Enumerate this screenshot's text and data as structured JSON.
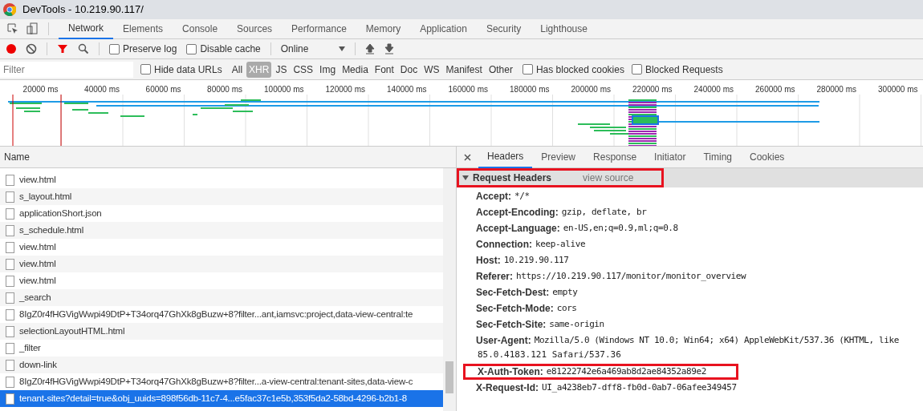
{
  "window": {
    "title": "DevTools - 10.219.90.117/"
  },
  "tabs": [
    {
      "label": "Network",
      "selected": true
    },
    {
      "label": "Elements",
      "selected": false
    },
    {
      "label": "Console",
      "selected": false
    },
    {
      "label": "Sources",
      "selected": false
    },
    {
      "label": "Performance",
      "selected": false
    },
    {
      "label": "Memory",
      "selected": false
    },
    {
      "label": "Application",
      "selected": false
    },
    {
      "label": "Security",
      "selected": false
    },
    {
      "label": "Lighthouse",
      "selected": false
    }
  ],
  "toolbar": {
    "recording": true,
    "filter_active": true,
    "preserve_log": {
      "label": "Preserve log",
      "checked": false
    },
    "disable_cache": {
      "label": "Disable cache",
      "checked": false
    },
    "throttling": "Online"
  },
  "filter_bar": {
    "placeholder": "Filter",
    "hide_data_urls": {
      "label": "Hide data URLs",
      "checked": false
    },
    "types": [
      {
        "label": "All",
        "selected": false
      },
      {
        "label": "XHR",
        "selected": true
      },
      {
        "label": "JS",
        "selected": false
      },
      {
        "label": "CSS",
        "selected": false
      },
      {
        "label": "Img",
        "selected": false
      },
      {
        "label": "Media",
        "selected": false
      },
      {
        "label": "Font",
        "selected": false
      },
      {
        "label": "Doc",
        "selected": false
      },
      {
        "label": "WS",
        "selected": false
      },
      {
        "label": "Manifest",
        "selected": false
      },
      {
        "label": "Other",
        "selected": false
      }
    ],
    "has_blocked_cookies": {
      "label": "Has blocked cookies",
      "checked": false
    },
    "blocked_requests": {
      "label": "Blocked Requests",
      "checked": false
    }
  },
  "overview": {
    "ticks": [
      "20000 ms",
      "40000 ms",
      "60000 ms",
      "80000 ms",
      "100000 ms",
      "120000 ms",
      "140000 ms",
      "160000 ms",
      "180000 ms",
      "200000 ms",
      "220000 ms",
      "240000 ms",
      "260000 ms",
      "280000 ms",
      "300000 ms"
    ]
  },
  "requests": {
    "column": "Name",
    "rows": [
      {
        "name": "view.html",
        "selected": false
      },
      {
        "name": "s_layout.html",
        "selected": false
      },
      {
        "name": "applicationShort.json",
        "selected": false
      },
      {
        "name": "s_schedule.html",
        "selected": false
      },
      {
        "name": "view.html",
        "selected": false
      },
      {
        "name": "view.html",
        "selected": false
      },
      {
        "name": "view.html",
        "selected": false
      },
      {
        "name": "_search",
        "selected": false
      },
      {
        "name": "8IgZ0r4fHGVigWwpi49DtP+T34orq47GhXk8gBuzw+8?filter...ant,iamsvc:project,data-view-central:te",
        "selected": false
      },
      {
        "name": "selectionLayoutHTML.html",
        "selected": false
      },
      {
        "name": "_filter",
        "selected": false
      },
      {
        "name": "down-link",
        "selected": false
      },
      {
        "name": "8IgZ0r4fHGVigWwpi49DtP+T34orq47GhXk8gBuzw+8?filter...a-view-central:tenant-sites,data-view-c",
        "selected": false
      },
      {
        "name": "tenant-sites?detail=true&obj_uuids=898f56db-11c7-4...e5fac37c1e5b,353f5da2-58bd-4296-b2b1-8",
        "selected": true
      }
    ]
  },
  "detail_tabs": [
    {
      "label": "Headers",
      "selected": true
    },
    {
      "label": "Preview",
      "selected": false
    },
    {
      "label": "Response",
      "selected": false
    },
    {
      "label": "Initiator",
      "selected": false
    },
    {
      "label": "Timing",
      "selected": false
    },
    {
      "label": "Cookies",
      "selected": false
    }
  ],
  "request_headers": {
    "title": "Request Headers",
    "expanded": true,
    "link": "view source",
    "highlighted": true,
    "items": [
      {
        "name": "Accept:",
        "value": "*/*",
        "highlighted": false
      },
      {
        "name": "Accept-Encoding:",
        "value": "gzip, deflate, br",
        "highlighted": false
      },
      {
        "name": "Accept-Language:",
        "value": "en-US,en;q=0.9,ml;q=0.8",
        "highlighted": false
      },
      {
        "name": "Connection:",
        "value": "keep-alive",
        "highlighted": false
      },
      {
        "name": "Host:",
        "value": "10.219.90.117",
        "highlighted": false
      },
      {
        "name": "Referer:",
        "value": "https://10.219.90.117/monitor/monitor_overview",
        "highlighted": false
      },
      {
        "name": "Sec-Fetch-Dest:",
        "value": "empty",
        "highlighted": false
      },
      {
        "name": "Sec-Fetch-Mode:",
        "value": "cors",
        "highlighted": false
      },
      {
        "name": "Sec-Fetch-Site:",
        "value": "same-origin",
        "highlighted": false
      },
      {
        "name": "User-Agent:",
        "value": "Mozilla/5.0 (Windows NT 10.0; Win64; x64) AppleWebKit/537.36 (KHTML, like",
        "continuation": "85.0.4183.121 Safari/537.36",
        "highlighted": false
      },
      {
        "name": "X-Auth-Token:",
        "value": "e81222742e6a469ab8d2ae84352a89e2",
        "highlighted": true
      },
      {
        "name": "X-Request-Id:",
        "value": "UI_a4238eb7-dff8-fb0d-0ab7-06afee349457",
        "highlighted": false
      }
    ]
  }
}
